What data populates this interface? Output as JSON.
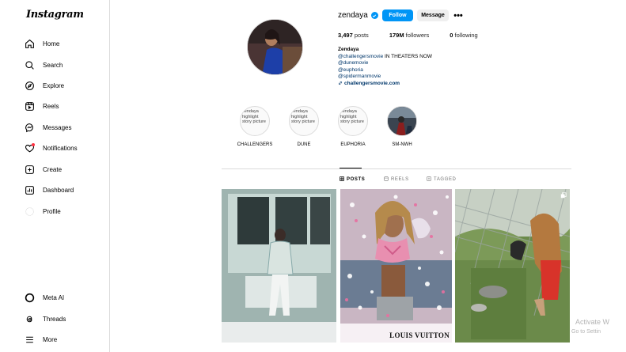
{
  "sidebar": {
    "logo": "Instagram",
    "items": [
      {
        "label": "Home",
        "icon": "home-icon"
      },
      {
        "label": "Search",
        "icon": "search-icon"
      },
      {
        "label": "Explore",
        "icon": "compass-icon"
      },
      {
        "label": "Reels",
        "icon": "reels-icon"
      },
      {
        "label": "Messages",
        "icon": "messenger-icon"
      },
      {
        "label": "Notifications",
        "icon": "heart-icon"
      },
      {
        "label": "Create",
        "icon": "plus-square-icon"
      },
      {
        "label": "Dashboard",
        "icon": "dashboard-icon"
      },
      {
        "label": "Profile",
        "icon": "avatar-icon"
      }
    ],
    "bottom": [
      {
        "label": "Meta AI",
        "icon": "meta-ai-icon"
      },
      {
        "label": "Threads",
        "icon": "threads-icon"
      },
      {
        "label": "More",
        "icon": "menu-icon"
      }
    ]
  },
  "profile": {
    "username": "zendaya",
    "follow_label": "Follow",
    "message_label": "Message",
    "more_label": "•••",
    "posts_count": "3,497",
    "posts_label": "posts",
    "followers_count": "179M",
    "followers_label": "followers",
    "following_count": "0",
    "following_label": "following",
    "full_name": "Zendaya",
    "bio_line1_mention": "@challengersmovie",
    "bio_line1_text": " IN THEATERS NOW",
    "bio_line2": "@dunemovie",
    "bio_line3": "@euphoria",
    "bio_line4": "@spidermanmovie",
    "external_link": "challengersmovie.com"
  },
  "highlights": [
    {
      "label": "CHALLENGERS",
      "alt": "zendaya highlight story picture"
    },
    {
      "label": "DUNE",
      "alt": "zendaya highlight story picture"
    },
    {
      "label": "EUPHORIA",
      "alt": "zendaya highlight story picture"
    },
    {
      "label": "SM-NWH",
      "alt": ""
    }
  ],
  "tabs": {
    "posts": "POSTS",
    "reels": "REELS",
    "tagged": "TAGGED"
  },
  "posts": [
    {
      "alt": "Polaroid photo",
      "brand": ""
    },
    {
      "alt": "Louis Vuitton campaign",
      "brand": "LOUIS VUITTON"
    },
    {
      "alt": "Outdoor photo",
      "brand": ""
    }
  ],
  "watermark": {
    "line1": "Activate W",
    "line2": "Go to Settin"
  },
  "colors": {
    "accent": "#0095f6",
    "link": "#00376b",
    "border": "#dbdbdb"
  }
}
